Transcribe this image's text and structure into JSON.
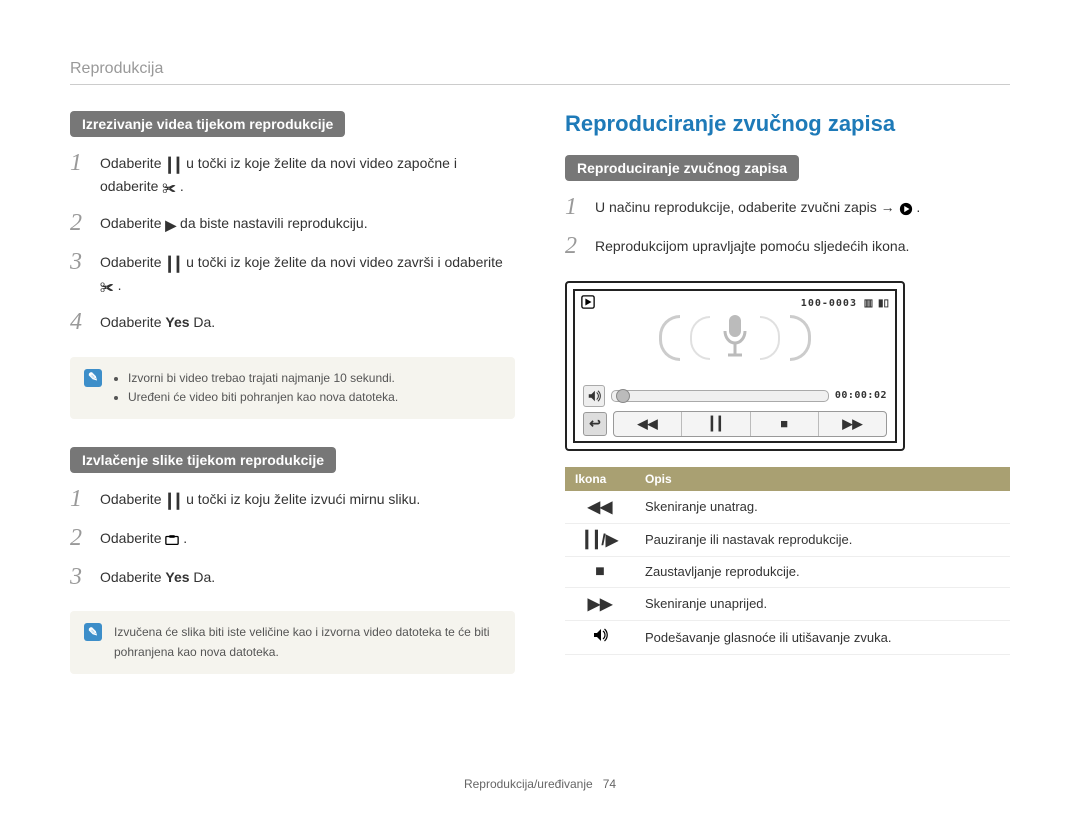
{
  "breadcrumb": "Reprodukcija",
  "left": {
    "section1_title": "Izrezivanje videa tijekom reprodukcije",
    "steps1": {
      "s1a": "Odaberite ",
      "s1b": " u točki iz koje želite da novi video započne i odaberite ",
      "s1c": ".",
      "s2a": "Odaberite ",
      "s2b": " da biste nastavili reprodukciju.",
      "s3a": "Odaberite ",
      "s3b": " u točki iz koje želite da novi video završi i odaberite ",
      "s3c": ".",
      "s4a": "Odaberite ",
      "s4b": "Yes",
      "s4c": " Da."
    },
    "note1_a": "Izvorni bi video trebao trajati najmanje 10 sekundi.",
    "note1_b": "Uređeni će video biti pohranjen kao nova datoteka.",
    "section2_title": "Izvlačenje slike tijekom reprodukcije",
    "steps2": {
      "s1a": "Odaberite ",
      "s1b": " u točki iz koju želite izvući mirnu sliku.",
      "s2a": "Odaberite ",
      "s2b": ".",
      "s3a": "Odaberite ",
      "s3b": "Yes",
      "s3c": " Da."
    },
    "note2": "Izvučena će slika biti iste veličine kao i izvorna video datoteka te će biti pohranjena kao nova datoteka."
  },
  "right": {
    "heading": "Reproduciranje zvučnog zapisa",
    "section_title": "Reproduciranje zvučnog zapisa",
    "steps": {
      "s1a": "U načinu reprodukcije, odaberite zvučni zapis → ",
      "s1b": ".",
      "s2": "Reprodukcijom upravljajte pomoću sljedećih ikona."
    },
    "device": {
      "file": "100-0003",
      "time": "00:00:02"
    },
    "table": {
      "h1": "Ikona",
      "h2": "Opis",
      "r1": "Skeniranje unatrag.",
      "r2": "Pauziranje ili nastavak reprodukcije.",
      "r3": "Zaustavljanje reprodukcije.",
      "r4": "Skeniranje unaprijed.",
      "r5": "Podešavanje glasnoće ili utišavanje zvuka."
    }
  },
  "footer": {
    "text": "Reprodukcija/uređivanje",
    "page": "74"
  }
}
